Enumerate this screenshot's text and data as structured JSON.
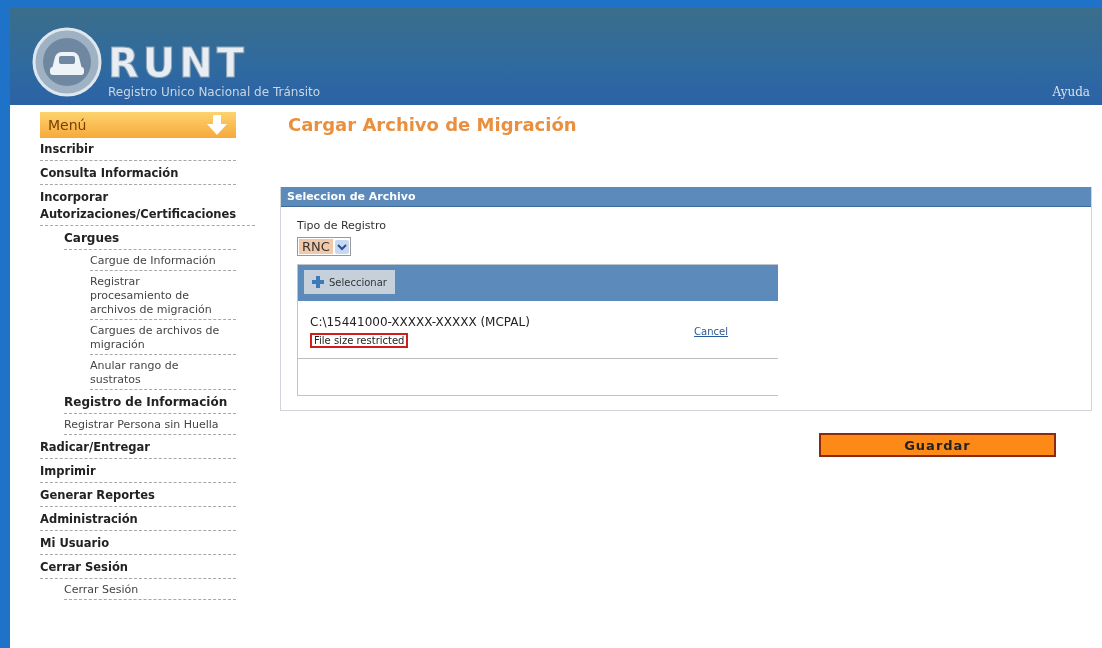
{
  "header": {
    "logo_text": "RUNT",
    "subtitle": "Registro Unico Nacional de Tránsito",
    "help_link": "Ayuda"
  },
  "sidebar": {
    "menu_title": "Menú",
    "items": [
      {
        "label": "Inscribir",
        "kind": "heading"
      },
      {
        "label": "Consulta Información",
        "kind": "heading"
      },
      {
        "label": "Incorporar Autorizaciones/Certificaciones",
        "kind": "heading",
        "children": [
          {
            "label": "Cargues",
            "kind": "heading",
            "children": [
              {
                "label": "Cargue de Información",
                "kind": "link"
              },
              {
                "label": "Registrar procesamiento de archivos de migración",
                "kind": "link"
              },
              {
                "label": "Cargues de archivos de migración",
                "kind": "link"
              },
              {
                "label": "Anular rango de sustratos",
                "kind": "link"
              }
            ]
          },
          {
            "label": "Registro de Información",
            "kind": "heading"
          },
          {
            "label": "Registrar Persona sin Huella",
            "kind": "link"
          }
        ]
      },
      {
        "label": "Radicar/Entregar",
        "kind": "heading"
      },
      {
        "label": "Imprimir",
        "kind": "heading"
      },
      {
        "label": "Generar Reportes",
        "kind": "heading"
      },
      {
        "label": "Administración",
        "kind": "heading"
      },
      {
        "label": "Mi Usuario",
        "kind": "heading"
      },
      {
        "label": "Cerrar Sesión",
        "kind": "heading",
        "children": [
          {
            "label": "Cerrar Sesión",
            "kind": "link"
          }
        ]
      }
    ]
  },
  "main": {
    "title": "Cargar Archivo de Migración",
    "panel": {
      "title": "Seleccion de Archivo",
      "field_label": "Tipo de Registro",
      "select_value": "RNC",
      "upload": {
        "button": "Seleccionar",
        "file": {
          "path": "C:\\15441000-XXXXX-XXXXX (MCPAL)",
          "error": "File size restricted",
          "cancel": "Cancel"
        }
      }
    },
    "save_button": "Guardar"
  }
}
